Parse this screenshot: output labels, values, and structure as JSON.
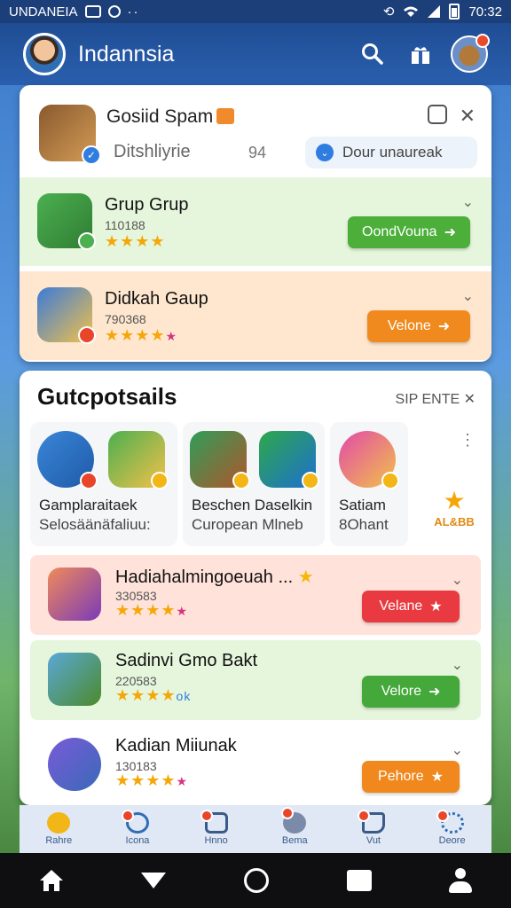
{
  "status_bar": {
    "carrier": "UNDANEIA",
    "time": "70:32"
  },
  "header": {
    "title": "Indannsia"
  },
  "promo": {
    "title": "Gosiid Spam",
    "subtitle": "Ditshliyrie",
    "count": "94",
    "pill_label": "Dour unaureak"
  },
  "top_rows": [
    {
      "name": "Grup Grup",
      "count": "110188",
      "stars": "★★★★",
      "extra": "",
      "button": "OondVouna",
      "button_arrow": "➜",
      "color": "#4caf3a"
    },
    {
      "name": "Didkah Gaup",
      "count": "790368",
      "stars": "★★★★",
      "extra": "★",
      "button": "Velone",
      "button_arrow": "➜",
      "color": "#f08a1e"
    }
  ],
  "suggestions": {
    "title": "Gutcpotsails",
    "see_all": "SIP ENTE",
    "grid": [
      {
        "line1": "Gamplaraitaek",
        "line2": "Selosäänäfaliuu:"
      },
      {
        "line1": "Beschen Daselkin",
        "line2": "Curopean Mlneb"
      },
      {
        "line1": "Satiam",
        "line2": "8Ohant"
      }
    ],
    "star_label": "AL&BB",
    "rows": [
      {
        "name": "Hadiahalmingoeuah ...",
        "count": "330583",
        "stars": "★★★★",
        "extra": "★",
        "button": "Velane",
        "button_arrow": "★",
        "color": "#e83a40"
      },
      {
        "name": "Sadinvi Gmo Bakt",
        "count": "220583",
        "stars": "★★★★",
        "extra": "ok",
        "button": "Velore",
        "button_arrow": "➜",
        "color": "#45a83a"
      },
      {
        "name": "Kadian Miiunak",
        "count": "130183",
        "stars": "★★★★",
        "extra": "★",
        "button": "Pehore",
        "button_arrow": "★",
        "color": "#f0881e"
      }
    ]
  },
  "tabs": [
    {
      "label": "Rahre"
    },
    {
      "label": "Icona"
    },
    {
      "label": "Hnno"
    },
    {
      "label": "Bema"
    },
    {
      "label": "Vut"
    },
    {
      "label": "Deore"
    }
  ]
}
